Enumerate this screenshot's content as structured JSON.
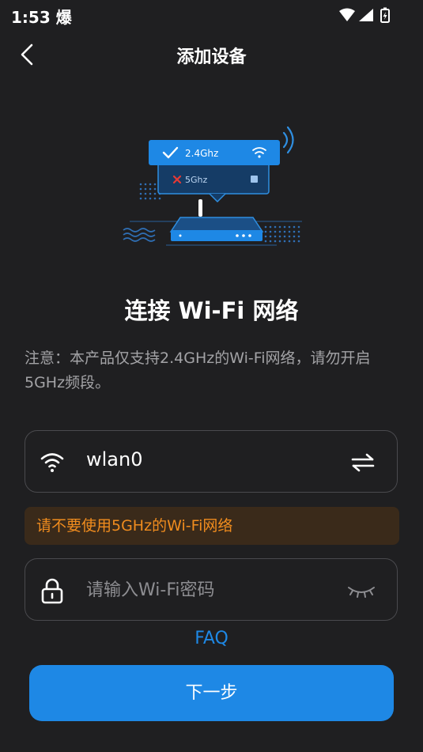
{
  "status_bar": {
    "time": "1:53 爆"
  },
  "header": {
    "title": "添加设备"
  },
  "illustration": {
    "band_24_label": "2.4Ghz",
    "band_5_label": "5Ghz"
  },
  "section": {
    "title": "连接 Wi-Fi 网络",
    "notice": "注意：本产品仅支持2.4GHz的Wi-Fi网络，请勿开启5GHz频段。"
  },
  "wifi": {
    "ssid": "wlan0"
  },
  "warning": {
    "text": "请不要使用5GHz的Wi-Fi网络"
  },
  "password": {
    "placeholder": "请输入Wi-Fi密码"
  },
  "faq_label": "FAQ",
  "next_button": "下一步",
  "colors": {
    "accent": "#1e88e5",
    "warning": "#f08c1e",
    "background": "#1f1f21"
  }
}
